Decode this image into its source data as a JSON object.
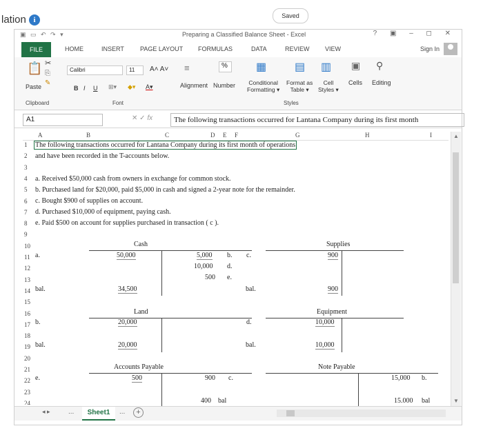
{
  "page": {
    "title": "lation 1",
    "saved": "Saved"
  },
  "window": {
    "title": "Preparing a Classified Balance Sheet - Excel",
    "controls": "? ▣ – ◻ ✕"
  },
  "ribbon_tabs": [
    "FILE",
    "HOME",
    "INSERT",
    "PAGE LAYOUT",
    "FORMULAS",
    "DATA",
    "REVIEW",
    "VIEW"
  ],
  "sign_in": "Sign In",
  "ribbon": {
    "font_name": "Calibri",
    "font_size": "11",
    "bold": "B",
    "italic": "I",
    "underline": "U",
    "paste": "Paste",
    "alignment": "Alignment",
    "number": "Number",
    "percent": "%",
    "conditional": "Conditional",
    "formatting": "Formatting",
    "format_as": "Format as",
    "table": "Table",
    "cell": "Cell",
    "styles_btn": "Styles",
    "cells": "Cells",
    "editing": "Editing",
    "groups": {
      "clipboard": "Clipboard",
      "font": "Font",
      "styles": "Styles"
    }
  },
  "formula_bar": {
    "name_box": "A1",
    "fx": "fx",
    "content": "The following transactions occurred for Lantana Company during its first month"
  },
  "columns": [
    "A",
    "B",
    "C",
    "D",
    "E",
    "F",
    "G",
    "H",
    "I"
  ],
  "rows": [
    "1",
    "2",
    "3",
    "4",
    "5",
    "6",
    "7",
    "8",
    "9",
    "10",
    "11",
    "12",
    "13",
    "14",
    "15",
    "16",
    "17",
    "18",
    "19",
    "20",
    "21",
    "22",
    "23",
    "24"
  ],
  "sheet": {
    "intro1": "The following transactions occurred for Lantana Company during its first month of operations",
    "intro2": "and have been recorded in the T-accounts below.",
    "tx": [
      "a. Received $50,000 cash from owners in exchange for common stock.",
      "b. Purchased land for $20,000, paid $5,000 in cash and signed a 2-year note for the remainder.",
      "c. Bought $900 of supplies on account.",
      "d. Purchased $10,000 of equipment, paying cash.",
      "e. Paid $500 on account for supplies purchased in transaction ( c )."
    ],
    "accounts": {
      "cash": "Cash",
      "supplies": "Supplies",
      "land": "Land",
      "equipment": "Equipment",
      "accounts_payable": "Accounts Payable",
      "note_payable": "Note Payable"
    },
    "cells": {
      "a11": "a.",
      "cash_dr": "50,000",
      "cash_cr1": "5,000",
      "cash_cr1_lbl": "b.",
      "cash_cr2": "10,000",
      "cash_cr2_lbl": "d.",
      "cash_cr3": "500",
      "cash_cr3_lbl": "e.",
      "sup_lbl": "c.",
      "sup_dr": "900",
      "bal14": "bal.",
      "cash_bal": "34,500",
      "sup_bal_lbl": "bal.",
      "sup_bal": "900",
      "b17": "b.",
      "land_dr": "20,000",
      "eq_lbl": "d.",
      "eq_dr": "10,000",
      "bal19": "bal.",
      "land_bal": "20,000",
      "eq_bal_lbl": "bal.",
      "eq_bal": "10,000",
      "e22": "e.",
      "ap_dr": "500",
      "ap_cr": "900",
      "ap_cr_lbl": "c.",
      "np_cr": "15,000",
      "np_cr_lbl": "b.",
      "ap_bal": "400",
      "ap_bal_lbl": "bal",
      "np_bal": "15,000",
      "np_bal_lbl": "bal"
    }
  },
  "sheet_tab": "Sheet1",
  "nav": {
    "ellipsis": "...",
    "add": "+"
  }
}
